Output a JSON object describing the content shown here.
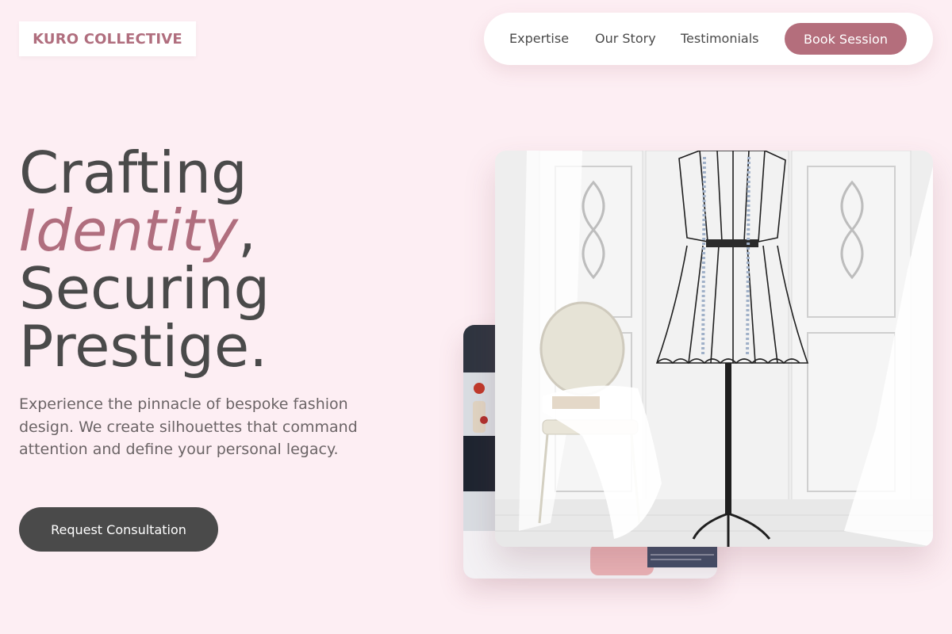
{
  "brand": {
    "name": "KURO COLLECTIVE"
  },
  "nav": {
    "links": [
      "Expertise",
      "Our Story",
      "Testimonials"
    ],
    "cta": "Book Session"
  },
  "hero": {
    "line1": "Crafting",
    "line2_accent": "Identity",
    "line2_punct": ",",
    "line3": "Securing",
    "line4": "Prestige.",
    "description": "Experience the pinnacle of bespoke fashion design. We create silhouettes that command attention and define your personal legacy.",
    "cta": "Request Consultation"
  },
  "images": {
    "main": "dress-form-studio-photo",
    "secondary": "sewing-workspace-photo"
  },
  "colors": {
    "background": "#fdeef3",
    "accent": "#b46e7c",
    "text": "#4a4a4a",
    "dark_button": "#4a4a4a"
  }
}
